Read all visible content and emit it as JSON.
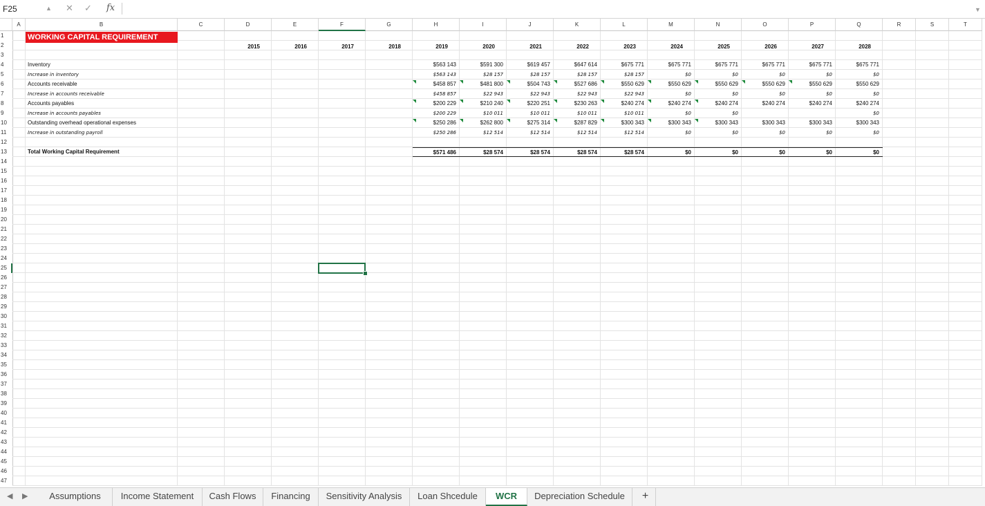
{
  "formula_bar": {
    "name_box": "F25",
    "cancel_icon": "x-icon",
    "enter_icon": "check-icon",
    "function_label": "fx",
    "formula": ""
  },
  "columns": [
    "A",
    "B",
    "C",
    "D",
    "E",
    "F",
    "G",
    "H",
    "I",
    "J",
    "K",
    "L",
    "M",
    "N",
    "O",
    "P",
    "Q",
    "R",
    "S",
    "T"
  ],
  "selected_column": "F",
  "row_numbers": [
    "1",
    "2",
    "3",
    "4",
    "5",
    "6",
    "7",
    "8",
    "9",
    "10",
    "11",
    "12",
    "13",
    "14",
    "15",
    "16",
    "17",
    "18",
    "19",
    "20",
    "21",
    "22",
    "23",
    "24",
    "25",
    "26",
    "27",
    "28",
    "29",
    "30",
    "31",
    "32",
    "33",
    "34",
    "35",
    "36",
    "37",
    "38",
    "39",
    "40",
    "41",
    "42",
    "43",
    "44",
    "45",
    "46",
    "47"
  ],
  "selected_row": "25",
  "sheet": {
    "title": "WORKING CAPITAL REQUIREMENT",
    "years": [
      "2015",
      "2016",
      "2017",
      "2018",
      "2019",
      "2020",
      "2021",
      "2022",
      "2023",
      "2024",
      "2025",
      "2026",
      "2027",
      "2028"
    ],
    "rows": [
      {
        "label": "Inventory",
        "values": [
          "$563 143",
          "$591 300",
          "$619 457",
          "$647 614",
          "$675 771",
          "$675 771",
          "$675 771",
          "$675 771",
          "$675 771",
          "$675 771"
        ]
      },
      {
        "label": "Increase in inventory",
        "values": [
          "$563 143",
          "$28 157",
          "$28 157",
          "$28 157",
          "$28 157",
          "$0",
          "$0",
          "$0",
          "$0",
          "$0"
        ]
      },
      {
        "label": "Accounts receivable",
        "values": [
          "$458 857",
          "$481 800",
          "$504 743",
          "$527 686",
          "$550 629",
          "$550 629",
          "$550 629",
          "$550 629",
          "$550 629",
          "$550 629"
        ]
      },
      {
        "label": "Increase in accounts receivable",
        "values": [
          "$458 857",
          "$22 943",
          "$22 943",
          "$22 943",
          "$22 943",
          "$0",
          "$0",
          "$0",
          "$0",
          "$0"
        ]
      },
      {
        "label": "Accounts payables",
        "values": [
          "$200 229",
          "$210 240",
          "$220 251",
          "$230 263",
          "$240 274",
          "$240 274",
          "$240 274",
          "$240 274",
          "$240 274",
          "$240 274"
        ]
      },
      {
        "label": "Increase in accounts payables",
        "values": [
          "$200 229",
          "$10 011",
          "$10 011",
          "$10 011",
          "$10 011",
          "$0",
          "$0",
          "",
          "",
          " $0"
        ]
      },
      {
        "label": "Outstanding overhead operational expenses",
        "values": [
          "$250 286",
          "$262 800",
          "$275 314",
          "$287 829",
          "$300 343",
          "$300 343",
          "$300 343",
          "$300 343",
          "$300 343",
          "$300 343"
        ]
      },
      {
        "label": "Increase in outstanding payroll",
        "values": [
          "$250 286",
          "$12 514",
          "$12 514",
          "$12 514",
          "$12 514",
          "$0",
          "$0",
          "$0",
          "$0",
          "$0"
        ]
      }
    ],
    "total_label": "Total Working Capital Requirement",
    "total_values": [
      "$571 486",
      "$28 574",
      "$28 574",
      "$28 574",
      "$28 574",
      "$0",
      "$0",
      "$0",
      "$0",
      "$0"
    ]
  },
  "tabs": [
    "Assumptions",
    "Income Statement",
    "Cash Flows",
    "Financing",
    "Sensitivity Analysis",
    "Loan Shcedule",
    "WCR",
    "Depreciation Schedule"
  ],
  "active_tab": "WCR",
  "add_sheet": "+",
  "colors": {
    "accent": "#217346",
    "title_bg": "#e8181f",
    "error_marker": "#1e8a3c"
  }
}
